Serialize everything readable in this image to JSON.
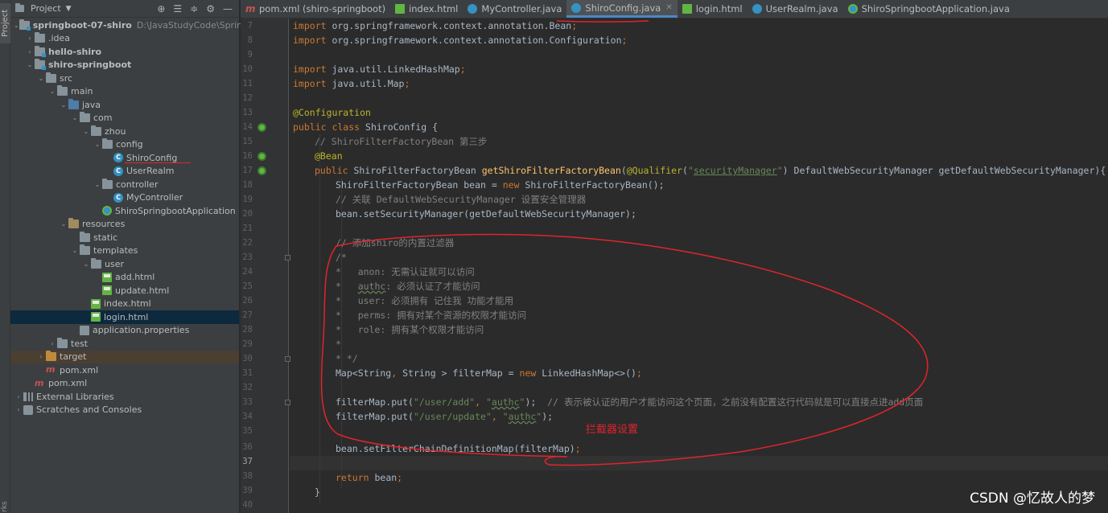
{
  "tool_strip": {
    "project_label": "Project",
    "bottom_label": "rks"
  },
  "project_panel": {
    "title": "Project",
    "items": [
      {
        "label": "springboot-07-shiro",
        "path": "D:\\JavaStudyCode\\SpringBoot",
        "icon": "module-folder-icon",
        "level": 0,
        "expanded": true
      },
      {
        "label": ".idea",
        "icon": "folder-icon",
        "level": 1,
        "expanded": false
      },
      {
        "label": "hello-shiro",
        "icon": "module-folder-icon",
        "level": 1,
        "expanded": false
      },
      {
        "label": "shiro-springboot",
        "icon": "module-folder-icon",
        "level": 1,
        "expanded": true
      },
      {
        "label": "src",
        "icon": "folder-icon",
        "level": 2,
        "expanded": true
      },
      {
        "label": "main",
        "icon": "folder-icon",
        "level": 3,
        "expanded": true
      },
      {
        "label": "java",
        "icon": "source-folder-icon",
        "level": 4,
        "expanded": true
      },
      {
        "label": "com",
        "icon": "package-icon",
        "level": 5,
        "expanded": true
      },
      {
        "label": "zhou",
        "icon": "package-icon",
        "level": 6,
        "expanded": true
      },
      {
        "label": "config",
        "icon": "package-icon",
        "level": 7,
        "expanded": true
      },
      {
        "label": "ShiroConfig",
        "icon": "java-class-icon",
        "level": 8
      },
      {
        "label": "UserRealm",
        "icon": "java-class-icon",
        "level": 8
      },
      {
        "label": "controller",
        "icon": "package-icon",
        "level": 7,
        "expanded": true
      },
      {
        "label": "MyController",
        "icon": "java-class-icon",
        "level": 8
      },
      {
        "label": "ShiroSpringbootApplication",
        "icon": "spring-boot-class-icon",
        "level": 7
      },
      {
        "label": "resources",
        "icon": "resources-folder-icon",
        "level": 4,
        "expanded": true
      },
      {
        "label": "static",
        "icon": "folder-icon",
        "level": 5
      },
      {
        "label": "templates",
        "icon": "folder-icon",
        "level": 5,
        "expanded": true
      },
      {
        "label": "user",
        "icon": "folder-icon",
        "level": 6,
        "expanded": true
      },
      {
        "label": "add.html",
        "icon": "html-file-icon",
        "level": 7
      },
      {
        "label": "update.html",
        "icon": "html-file-icon",
        "level": 7
      },
      {
        "label": "index.html",
        "icon": "html-file-icon",
        "level": 6
      },
      {
        "label": "login.html",
        "icon": "html-file-icon",
        "level": 6
      },
      {
        "label": "application.properties",
        "icon": "properties-file-icon",
        "level": 5
      },
      {
        "label": "test",
        "icon": "folder-icon",
        "level": 3,
        "expanded": false
      },
      {
        "label": "target",
        "icon": "excluded-folder-icon",
        "level": 2,
        "expanded": false
      },
      {
        "label": "pom.xml",
        "icon": "maven-icon",
        "level": 2
      },
      {
        "label": "pom.xml",
        "icon": "maven-icon",
        "level": 1
      },
      {
        "label": "External Libraries",
        "icon": "libraries-icon",
        "level": 0,
        "expanded": false
      },
      {
        "label": "Scratches and Consoles",
        "icon": "scratches-icon",
        "level": 0,
        "expanded": false
      }
    ]
  },
  "tabs": [
    {
      "label": "pom.xml (shiro-springboot)",
      "icon": "maven-icon",
      "active": false
    },
    {
      "label": "index.html",
      "icon": "html-file-icon",
      "active": false
    },
    {
      "label": "MyController.java",
      "icon": "java-class-icon",
      "active": false
    },
    {
      "label": "ShiroConfig.java",
      "icon": "java-class-icon",
      "active": true
    },
    {
      "label": "login.html",
      "icon": "html-file-icon",
      "active": false
    },
    {
      "label": "UserRealm.java",
      "icon": "java-class-icon",
      "active": false
    },
    {
      "label": "ShiroSpringbootApplication.java",
      "icon": "spring-boot-class-icon",
      "active": false
    }
  ],
  "editor": {
    "line_numbers": [
      "7",
      "8",
      "9",
      "10",
      "11",
      "12",
      "13",
      "14",
      "15",
      "16",
      "17",
      "18",
      "19",
      "20",
      "21",
      "22",
      "23",
      "24",
      "25",
      "26",
      "27",
      "28",
      "29",
      "30",
      "31",
      "32",
      "33",
      "34",
      "35",
      "36",
      "37",
      "38",
      "39",
      "40"
    ],
    "current_line": "37",
    "lines": {
      "l7_a": "import ",
      "l7_b": "org.springframework.context.annotation.",
      "l7_c": "Bean",
      "l7_d": ";",
      "l8_a": "import ",
      "l8_b": "org.springframework.context.annotation.",
      "l8_c": "Configuration",
      "l8_d": ";",
      "l10_a": "import ",
      "l10_b": "java.util.LinkedHashMap",
      "l10_c": ";",
      "l11_a": "import ",
      "l11_b": "java.util.Map",
      "l11_c": ";",
      "l13": "@Configuration",
      "l14_a": "public class ",
      "l14_b": "ShiroConfig {",
      "l15": "// ShiroFilterFactoryBean 第三步",
      "l16": "@Bean",
      "l17_a": "public ",
      "l17_b": "ShiroFilterFactoryBean ",
      "l17_c": "getShiroFilterFactoryBean",
      "l17_d": "(",
      "l17_e": "@Qualifier",
      "l17_f": "(",
      "l17_g": "\"",
      "l17_h": "securityManager",
      "l17_i": "\"",
      "l17_j": ") DefaultWebSecurityManager getDefaultWebSecurityManager){",
      "l18_a": "ShiroFilterFactoryBean bean = ",
      "l18_b": "new ",
      "l18_c": "ShiroFilterFactoryBean();",
      "l19": "// 关联 DefaultWebSecurityManager 设置安全管理器",
      "l20": "bean.setSecurityManager(getDefaultWebSecurityManager);",
      "l22": "// 添加shiro的内置过滤器",
      "l23": "/*",
      "l24_a": "*   anon: 无需认证就可以访问",
      "l25_a": "*   ",
      "l25_b": "authc",
      "l25_c": ": 必须认证了才能访问",
      "l26": "*   user: 必须拥有 记住我 功能才能用",
      "l27": "*   perms: 拥有对某个资源的权限才能访问",
      "l28": "*   role: 拥有某个权限才能访问",
      "l29": "*",
      "l30": "* */",
      "l31_a": "Map<String",
      "l31_b": ", ",
      "l31_c": "String > filterMap = ",
      "l31_d": "new ",
      "l31_e": "LinkedHashMap<>()",
      "l31_f": ";",
      "l33_a": "filterMap.put(",
      "l33_b": "\"/user/add\"",
      "l33_c": ", ",
      "l33_d": "\"",
      "l33_e": "authc",
      "l33_f": "\"",
      "l33_g": ");  ",
      "l33_h": "// 表示被认证的用户才能访问这个页面，之前没有配置这行代码就是可以直接点进add页面",
      "l34_a": "filterMap.put(",
      "l34_b": "\"/user/update\"",
      "l34_c": ", ",
      "l34_d": "\"",
      "l34_e": "authc",
      "l34_f": "\"",
      "l34_g": ");",
      "l36_a": "bean.setFilterChainDefinitionMap(filterMap)",
      "l36_b": ";",
      "l38_a": "return ",
      "l38_b": "bean",
      "l38_c": ";",
      "l39": "}"
    }
  },
  "annotation": {
    "text": "拦截器设置",
    "color": "#e0242c"
  },
  "watermark": "CSDN @忆故人的梦",
  "colors": {
    "keyword": "#cc7832",
    "annotation": "#bbb529",
    "string": "#6a8759",
    "comment": "#808080",
    "method": "#ffc66d",
    "text": "#a9b7c6",
    "accent": "#4a88c7",
    "red_markup": "#e0242c"
  }
}
